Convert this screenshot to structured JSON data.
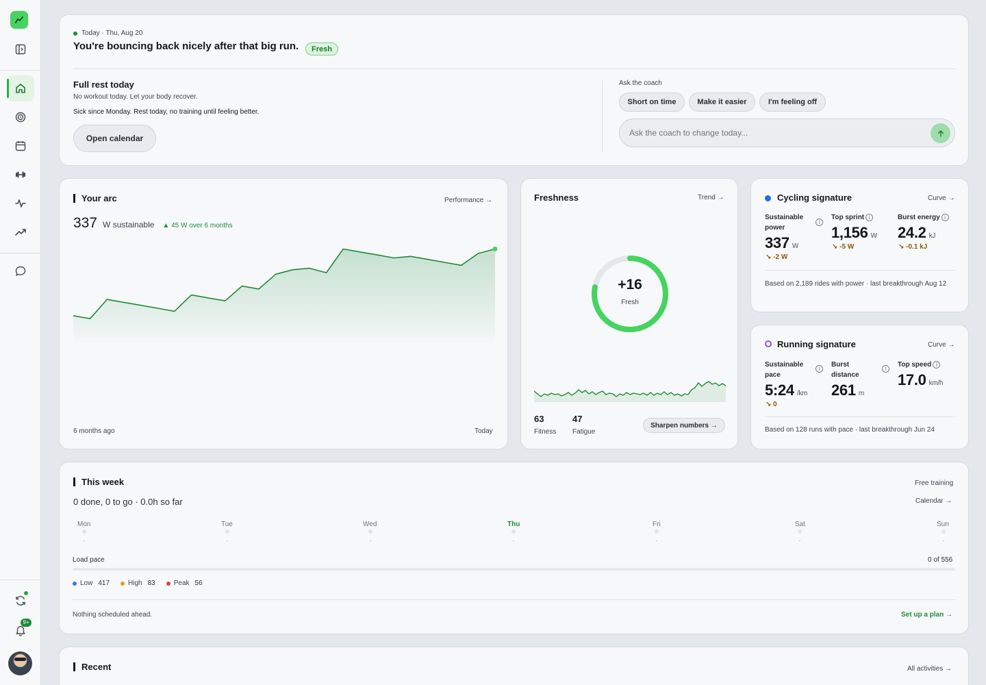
{
  "today": {
    "date": "Today · Thu, Aug 20",
    "headline": "You're bouncing back nicely after that big run.",
    "badge": "Fresh",
    "plan_title": "Full rest today",
    "plan_desc": "No workout today. Let your body recover.",
    "note": "Sick since Monday. Rest today, no training until feeling better.",
    "open_calendar": "Open calendar",
    "coach_label": "Ask the coach",
    "chips": [
      "Short on time",
      "Make it easier",
      "I'm feeling off"
    ],
    "coach_placeholder": "Ask the coach to change today..."
  },
  "arc": {
    "title": "Your arc",
    "link": "Performance →",
    "value": "337",
    "unit": "W sustainable",
    "trend": "▲ 45 W over 6 months",
    "start_label": "6 months ago",
    "end_label": "Today"
  },
  "chart_data": {
    "type": "area",
    "title": "",
    "xlabel": "",
    "ylabel": "",
    "x_start": "6 months ago",
    "x_end": "Today",
    "series": [
      {
        "values": [
          292,
          290,
          303,
          301,
          299,
          297,
          295,
          306,
          304,
          302,
          312,
          310,
          320,
          323,
          324,
          321,
          337,
          335,
          333,
          331,
          332,
          330,
          328,
          326,
          334,
          337
        ]
      }
    ]
  },
  "freshness": {
    "title": "Freshness",
    "link": "Trend →",
    "value": "+16",
    "label": "Fresh",
    "ring_fraction": 0.78,
    "fitness_value": "63",
    "fitness_label": "Fitness",
    "fatigue_value": "47",
    "fatigue_label": "Fatigue",
    "sharpen": "Sharpen numbers →"
  },
  "cycling": {
    "title": "Cycling signature",
    "link": "Curve →",
    "m1_label": "Sustainable power",
    "m1_value": "337",
    "m1_unit": "W",
    "m1_delta": "↘ -2 W",
    "m2_label": "Top sprint",
    "m2_value": "1,156",
    "m2_unit": "W",
    "m2_delta": "↘ -5 W",
    "m3_label": "Burst energy",
    "m3_value": "24.2",
    "m3_unit": "kJ",
    "m3_delta": "↘ -0.1 kJ",
    "footer": "Based on 2,189 rides with power · last breakthrough Aug 12"
  },
  "running": {
    "title": "Running signature",
    "link": "Curve →",
    "m1_label": "Sustainable pace",
    "m1_value": "5:24",
    "m1_unit": "/km",
    "m1_delta": "↘ 0",
    "m2_label": "Burst distance",
    "m2_value": "261",
    "m2_unit": "m",
    "m3_label": "Top speed",
    "m3_value": "17.0",
    "m3_unit": "km/h",
    "footer": "Based on 128 runs with pace · last breakthrough Jun 24"
  },
  "week": {
    "title": "This week",
    "free": "Free training",
    "summary": "0 done, 0 to go · 0.0h so far",
    "calendar": "Calendar →",
    "days": [
      "Mon",
      "Tue",
      "Wed",
      "Thu",
      "Fri",
      "Sat",
      "Sun"
    ],
    "load_label": "Load pace",
    "load_value": "0 of 556",
    "low_label": "Low",
    "low_value": "417",
    "high_label": "High",
    "high_value": "83",
    "peak_label": "Peak",
    "peak_value": "56",
    "nothing": "Nothing scheduled ahead.",
    "setup": "Set up a plan →"
  },
  "recent": {
    "title": "Recent",
    "all": "All activities →"
  },
  "colors": {
    "accent": "#1f8a3a",
    "accent_light": "#46d35f",
    "cycling": "#1f6fe5",
    "running": "#8a5ad6",
    "low": "#3f78d6",
    "high": "#d9a21b",
    "peak": "#d64545"
  }
}
